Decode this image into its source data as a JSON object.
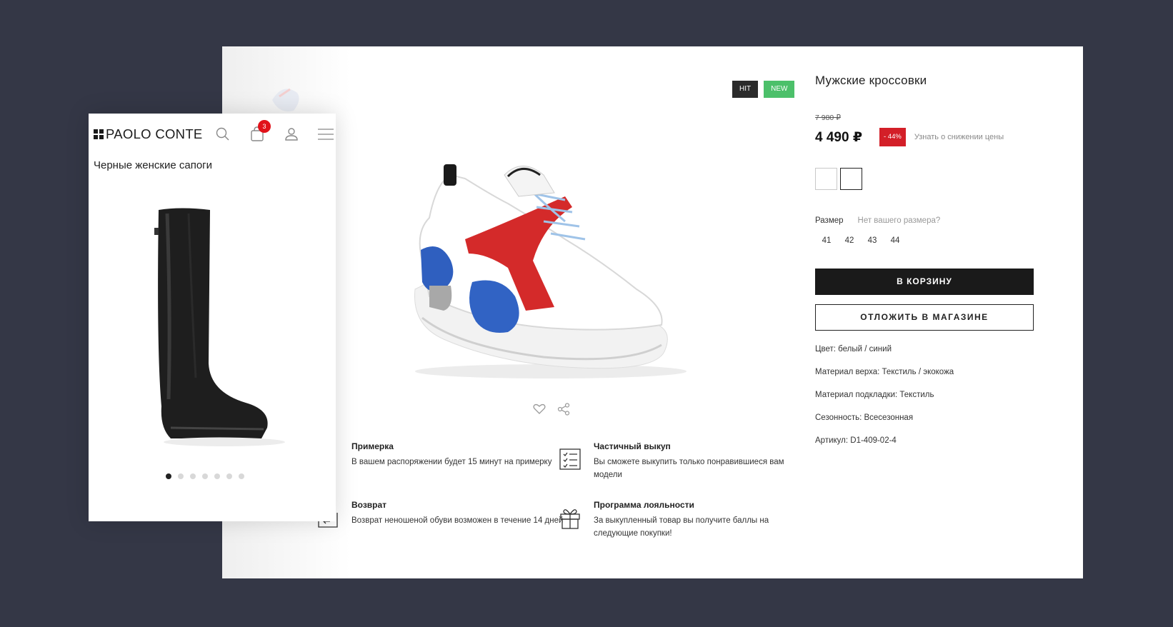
{
  "desktop": {
    "badges": {
      "hit": "HIT",
      "new": "NEW"
    },
    "product": {
      "title": "Мужские кроссовки",
      "old_price": "7 980 ₽",
      "price": "4 490 ₽",
      "discount": "- 44%",
      "price_notify": "Узнать о снижении цены",
      "size_label": "Размер",
      "size_help": "Нет вашего размера?",
      "sizes": [
        "41",
        "42",
        "43",
        "44"
      ],
      "add_to_cart": "В КОРЗИНУ",
      "reserve": "ОТЛОЖИТЬ В МАГАЗИНЕ",
      "attributes": [
        "Цвет: белый / синий",
        "Материал верха: Текстиль / экокожа",
        "Материал подкладки: Текстиль",
        "Сезонность: Всесезонная",
        "Артикул: D1-409-02-4"
      ]
    },
    "features": [
      {
        "title": "Примерка",
        "text": "В вашем распоряжении будет 15 минут на примерку",
        "icon": "fitting-icon"
      },
      {
        "title": "Частичный выкуп",
        "text": "Вы сможете выкупить только понравившиеся вам модели",
        "icon": "checklist-icon"
      },
      {
        "title": "Возврат",
        "text": "Возврат неношеной обуви возможен в течение 14 дней",
        "icon": "return-icon"
      },
      {
        "title": "Программа лояльности",
        "text": "За выкупленный товар вы получите баллы на следующие покупки!",
        "icon": "gift-icon"
      }
    ],
    "colors": {
      "hit": "#2b2b2b",
      "new": "#4cc06a",
      "discount": "#d31f28"
    }
  },
  "mobile": {
    "logo": "PAOLO CONTE",
    "cart_count": "3",
    "title": "Черные женские сапоги",
    "gallery_dots": 7,
    "active_dot": 0
  }
}
